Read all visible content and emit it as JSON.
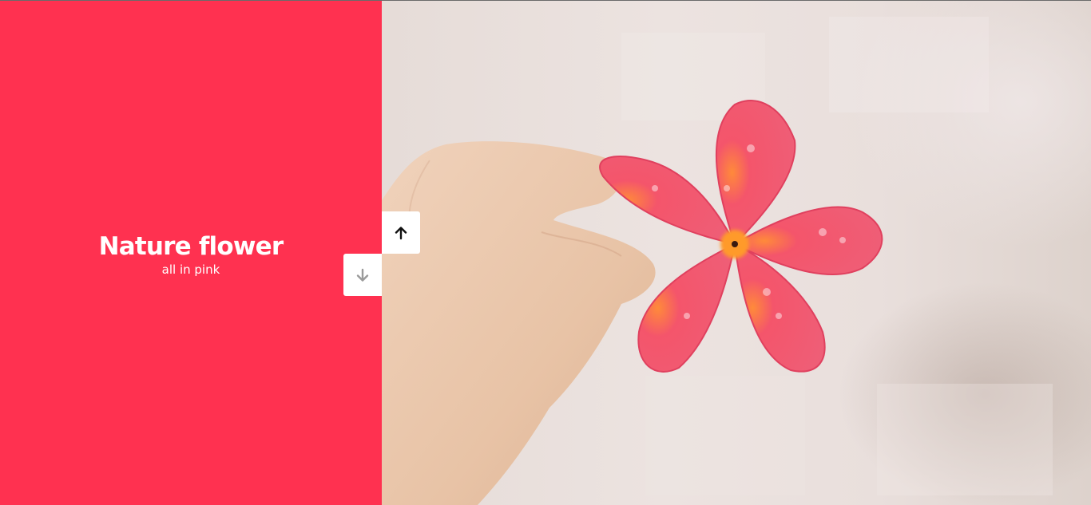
{
  "slide": {
    "title": "Nature flower",
    "subtitle": "all in pink",
    "image_description_icon": "flower-photo"
  },
  "navigation": {
    "up_icon": "arrow-up-icon",
    "down_icon": "arrow-down-icon",
    "up_active": true,
    "down_active": false
  },
  "colors": {
    "panel": "#ff3150",
    "button_bg": "#ffffff",
    "arrow_active": "#111111",
    "arrow_inactive": "#9a9a9a"
  }
}
